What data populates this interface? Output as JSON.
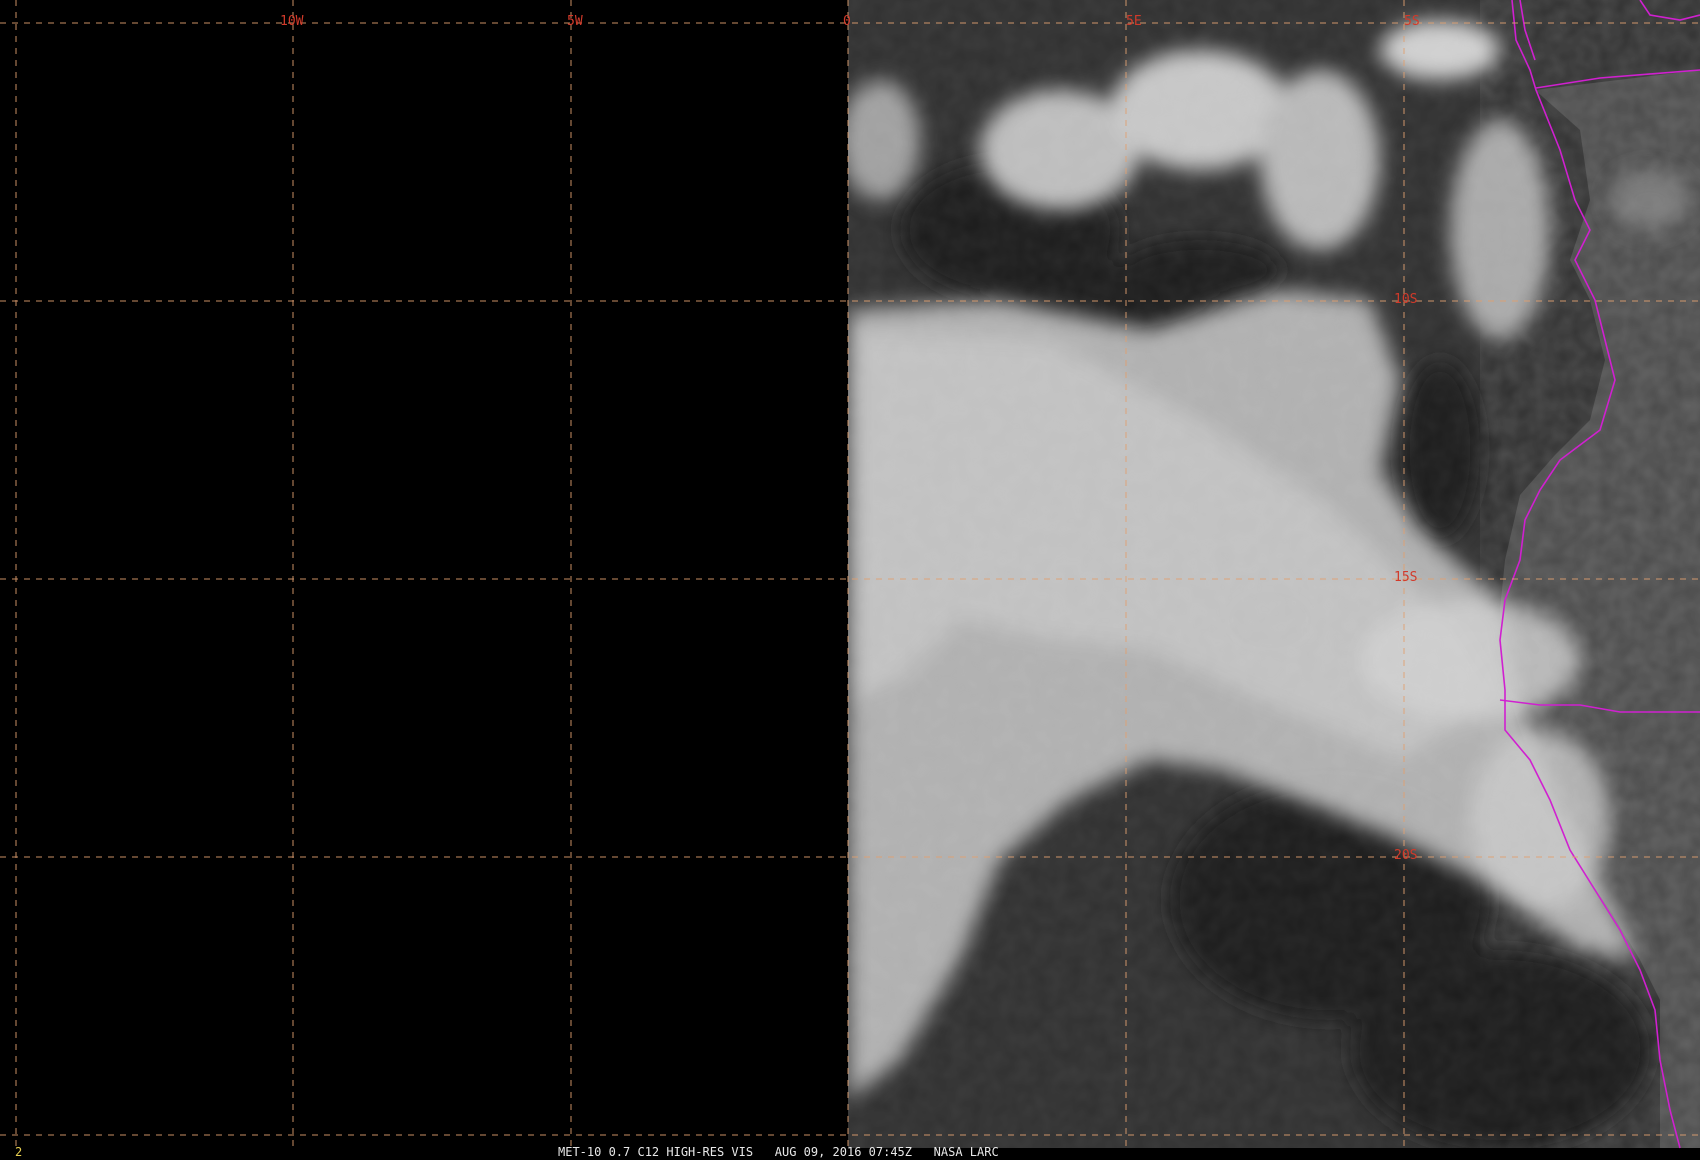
{
  "image": {
    "type": "satellite-visible",
    "colors": {
      "background": "#000000",
      "graticule": "#e0a070",
      "graticule_label": "#d23a2a",
      "coastline": "#d020d0",
      "status_text": "#e8e8e8",
      "frame_label": "#e8d050"
    }
  },
  "graticule": {
    "longitude_labels": [
      {
        "text": "10W",
        "lon": -10
      },
      {
        "text": "5W",
        "lon": -5
      },
      {
        "text": "0",
        "lon": 0
      },
      {
        "text": "5E",
        "lon": 5
      },
      {
        "text": "5S",
        "lon": 10
      }
    ],
    "latitude_labels": [
      {
        "text": "10S",
        "lat": -10
      },
      {
        "text": "15S",
        "lat": -15
      },
      {
        "text": "20S",
        "lat": -20
      }
    ]
  },
  "status_bar": {
    "frame_number": "2",
    "caption": "MET-10 0.7 C12 HIGH-RES VIS   AUG 09, 2016 07:45Z   NASA LARC"
  }
}
